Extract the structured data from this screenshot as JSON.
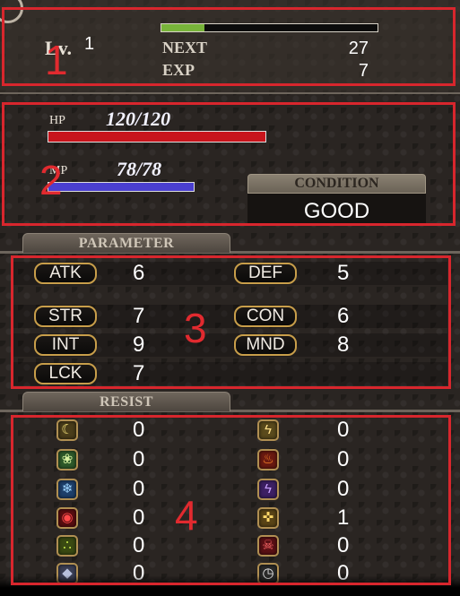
{
  "level": {
    "label": "Lv.",
    "value": "1",
    "exp_progress": 0.2
  },
  "next": {
    "label": "NEXT",
    "value": "27"
  },
  "exp": {
    "label": "EXP",
    "value": "7"
  },
  "hp": {
    "label": "HP",
    "text": "120/120",
    "fraction": 1.0,
    "color": "#c8141c"
  },
  "mp": {
    "label": "MP",
    "text": "78/78",
    "fraction": 1.0,
    "color": "#4a3fd0"
  },
  "condition": {
    "label": "CONDITION",
    "value": "GOOD"
  },
  "parameter": {
    "title": "PARAMETER",
    "stats": [
      {
        "name": "ATK",
        "value": "6"
      },
      {
        "name": "DEF",
        "value": "5"
      },
      {
        "name": "STR",
        "value": "7"
      },
      {
        "name": "CON",
        "value": "6"
      },
      {
        "name": "INT",
        "value": "9"
      },
      {
        "name": "MND",
        "value": "8"
      },
      {
        "name": "LCK",
        "value": "7"
      }
    ]
  },
  "resist": {
    "title": "RESIST",
    "items": [
      {
        "icon": "crescent-moon-icon",
        "value": "0"
      },
      {
        "icon": "lightning-bolt-icon",
        "value": "0"
      },
      {
        "icon": "wind-icon",
        "value": "0"
      },
      {
        "icon": "fire-icon",
        "value": "0"
      },
      {
        "icon": "ice-crystal-icon",
        "value": "0"
      },
      {
        "icon": "electric-icon",
        "value": "0"
      },
      {
        "icon": "swirl-icon",
        "value": "0"
      },
      {
        "icon": "holy-cross-icon",
        "value": "1"
      },
      {
        "icon": "poison-bubbles-icon",
        "value": "0"
      },
      {
        "icon": "skull-icon",
        "value": "0"
      },
      {
        "icon": "rock-icon",
        "value": "0"
      },
      {
        "icon": "stopwatch-icon",
        "value": "0"
      }
    ]
  },
  "annotations": [
    "1",
    "2",
    "3",
    "4"
  ]
}
